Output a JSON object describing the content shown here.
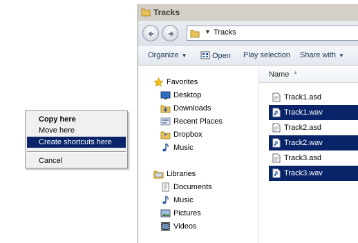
{
  "context_menu": {
    "items": [
      {
        "label": "Copy here",
        "bold": true
      },
      {
        "label": "Move here"
      },
      {
        "label": "Create shortcuts here",
        "selected": true
      },
      {
        "label": "Cancel"
      }
    ]
  },
  "window": {
    "title": "Tracks",
    "address": "Tracks"
  },
  "toolbar": {
    "organize": "Organize",
    "open": "Open",
    "play_selection": "Play selection",
    "share_with": "Share with"
  },
  "nav": {
    "favorites": {
      "label": "Favorites",
      "items": [
        "Desktop",
        "Downloads",
        "Recent Places",
        "Dropbox",
        "Music"
      ]
    },
    "libraries": {
      "label": "Libraries",
      "items": [
        "Documents",
        "Music",
        "Pictures",
        "Videos"
      ]
    }
  },
  "files": {
    "column_name": "Name",
    "items": [
      {
        "name": "Track1.asd",
        "selected": false
      },
      {
        "name": "Track1.wav",
        "selected": true
      },
      {
        "name": "Track2.asd",
        "selected": false
      },
      {
        "name": "Track2.wav",
        "selected": true
      },
      {
        "name": "Track3.asd",
        "selected": false
      },
      {
        "name": "Track3.wav",
        "selected": true
      }
    ]
  },
  "colors": {
    "selection": "#0a246a",
    "menu_bg": "#f0f0f0",
    "title_bg": "#d4d0c8"
  }
}
